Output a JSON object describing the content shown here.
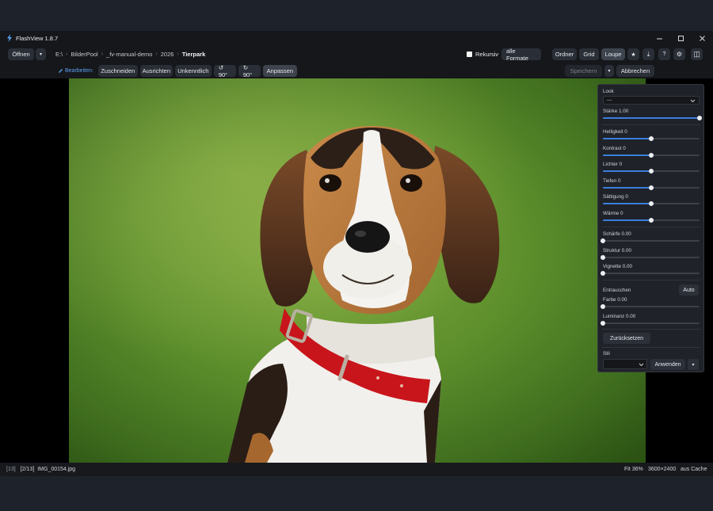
{
  "window": {
    "title": "FlashView 1.8.7"
  },
  "toolbar": {
    "open_label": "Öffnen",
    "open_menu_glyph": "▾",
    "breadcrumb": [
      "E:\\",
      "BilderPool",
      "_fv-manual-demo",
      "2026",
      "Tierpark"
    ],
    "recursive_label": "Rekursiv",
    "formats_label": "alle Formate",
    "view_modes": [
      "Ordner",
      "Grid",
      "Loupe"
    ],
    "active_view": "Loupe",
    "star_glyph": "★",
    "download_glyph": "⤓",
    "help_glyph": "?",
    "settings_glyph": "⚙",
    "panel_glyph": "◫"
  },
  "edit_bar": {
    "label": "Bearbeiten:",
    "tools": [
      "Zuschneiden",
      "Ausrichten",
      "Unkenntlich"
    ],
    "rotate_left": "↺ 90°",
    "rotate_right": "↻ 90°",
    "adjust": "Anpassen",
    "save": "Speichern",
    "save_menu_glyph": "▾",
    "cancel": "Abbrechen"
  },
  "adjust_panel": {
    "look_label": "Look",
    "look_value": "—",
    "strength_label": "Stärke 1.00",
    "strength": 1.0,
    "sliders": [
      {
        "label": "Helligkeit 0",
        "value": 0.5
      },
      {
        "label": "Kontrast 0",
        "value": 0.5
      },
      {
        "label": "Lichter 0",
        "value": 0.5
      },
      {
        "label": "Tiefen 0",
        "value": 0.5
      },
      {
        "label": "Sättigung 0",
        "value": 0.5
      },
      {
        "label": "Wärme 0",
        "value": 0.5
      }
    ],
    "detail_sliders": [
      {
        "label": "Schärfe 0.00",
        "value": 0.0
      },
      {
        "label": "Struktur 0.00",
        "value": 0.0
      },
      {
        "label": "Vignette 0.00",
        "value": 0.0
      }
    ],
    "denoise_label": "Entrauschen",
    "denoise_auto": "Auto",
    "denoise_sliders": [
      {
        "label": "Farbe 0.00",
        "value": 0.0
      },
      {
        "label": "Luminanz 0.00",
        "value": 0.0
      }
    ],
    "reset_label": "Zurücksetzen",
    "style_label": "Stil",
    "apply_label": "Anwenden",
    "apply_menu_glyph": "▾"
  },
  "status": {
    "count": "[13]",
    "position": "[2/13]",
    "filename": "IMG_00154.jpg",
    "zoom": "Fit 36%",
    "dimensions": "3600×2400",
    "source": "aus Cache"
  },
  "colors": {
    "accent": "#3a7fdc",
    "accent_text": "#5aa0ee",
    "background": "#15171b",
    "collar": "#c8151b"
  }
}
